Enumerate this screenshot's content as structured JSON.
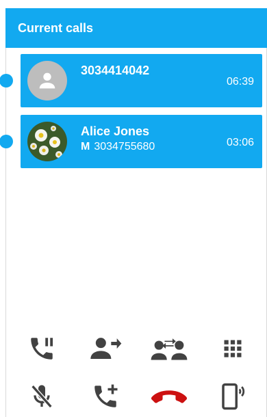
{
  "header": {
    "title": "Current calls"
  },
  "calls": [
    {
      "name": "3034414042",
      "type": "",
      "number": "",
      "duration": "06:39"
    },
    {
      "name": "Alice Jones",
      "type": "M",
      "number": "3034755680",
      "duration": "03:06"
    }
  ],
  "controls": {
    "row1": [
      "hold-call-icon",
      "transfer-icon",
      "swap-calls-icon",
      "dialpad-icon"
    ],
    "row2": [
      "mute-mic-icon",
      "add-call-icon",
      "end-call-icon",
      "speaker-phone-icon"
    ]
  },
  "colors": {
    "accent": "#12a9f0",
    "icon": "#424242",
    "end_call": "#cc1111"
  }
}
